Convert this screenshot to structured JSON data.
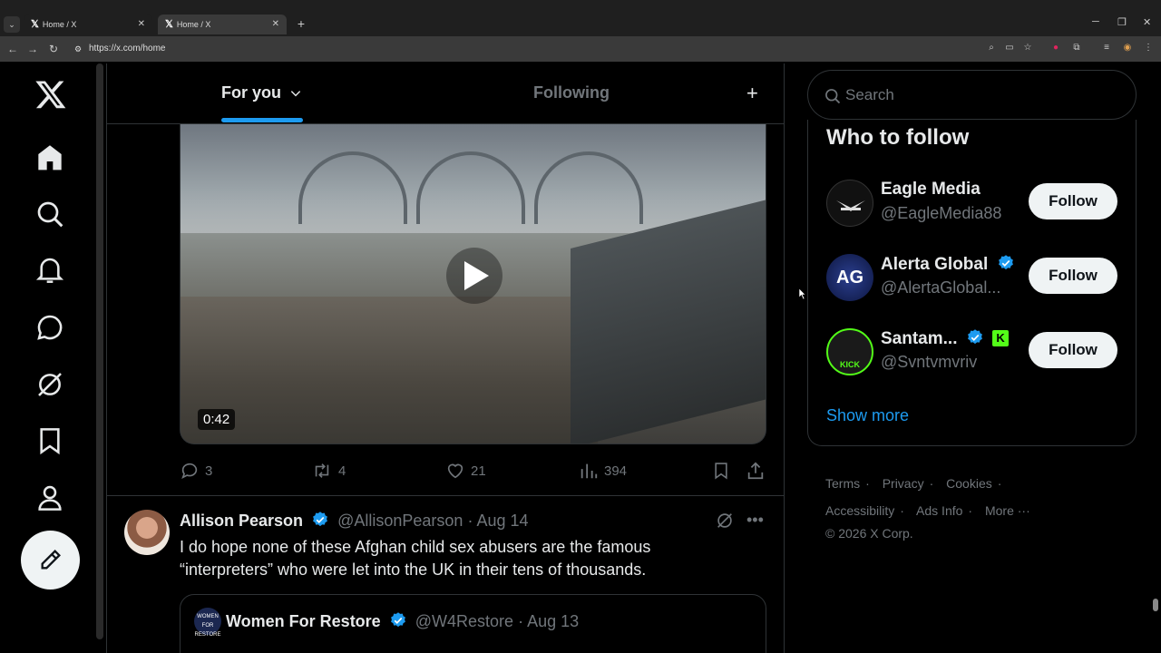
{
  "browser": {
    "tabs": [
      {
        "title": "Home / X",
        "active": false
      },
      {
        "title": "Home / X",
        "active": true
      }
    ],
    "url": "https://x.com/home"
  },
  "header": {
    "tab_foryou": "For you",
    "tab_following": "Following"
  },
  "video": {
    "duration": "0:42"
  },
  "tweet1_actions": {
    "replies": "3",
    "reposts": "4",
    "likes": "21",
    "views": "394"
  },
  "tweet2": {
    "name": "Allison Pearson",
    "handle": "@AllisonPearson",
    "date": "· Aug 14",
    "text_line1": "I do hope none of these Afghan  child sex abusers are the famous",
    "text_line2": "“interpreters” who were let into the UK in their tens of thousands.",
    "quote": {
      "avatar_text": "WOMEN FOR RESTORE",
      "name": "Women For Restore",
      "handle": "@W4Restore",
      "date": "· Aug 13"
    }
  },
  "search": {
    "placeholder": "Search"
  },
  "who_to_follow": {
    "title": "Who to follow",
    "people": [
      {
        "name": "Eagle Media",
        "handle": "@EagleMedia88",
        "verified": false,
        "button": "Follow"
      },
      {
        "name": "Alerta Global",
        "handle": "@AlertaGlobal...",
        "verified": true,
        "avatar_text": "AG",
        "button": "Follow"
      },
      {
        "name": "Santam...",
        "handle": "@Svntvmvriv",
        "verified": true,
        "badge": "K",
        "avatar_text": "KICK",
        "button": "Follow"
      }
    ],
    "show_more": "Show more"
  },
  "footer": {
    "terms": "Terms",
    "privacy": "Privacy",
    "cookies": "Cookies",
    "accessibility": "Accessibility",
    "ads_info": "Ads Info",
    "more": "More ···",
    "copyright": "© 2026 X Corp."
  },
  "colors": {
    "accent": "#1d9bf0",
    "background": "#000000",
    "text": "#e7e9ea",
    "muted": "#71767b",
    "border": "#2f3336"
  }
}
